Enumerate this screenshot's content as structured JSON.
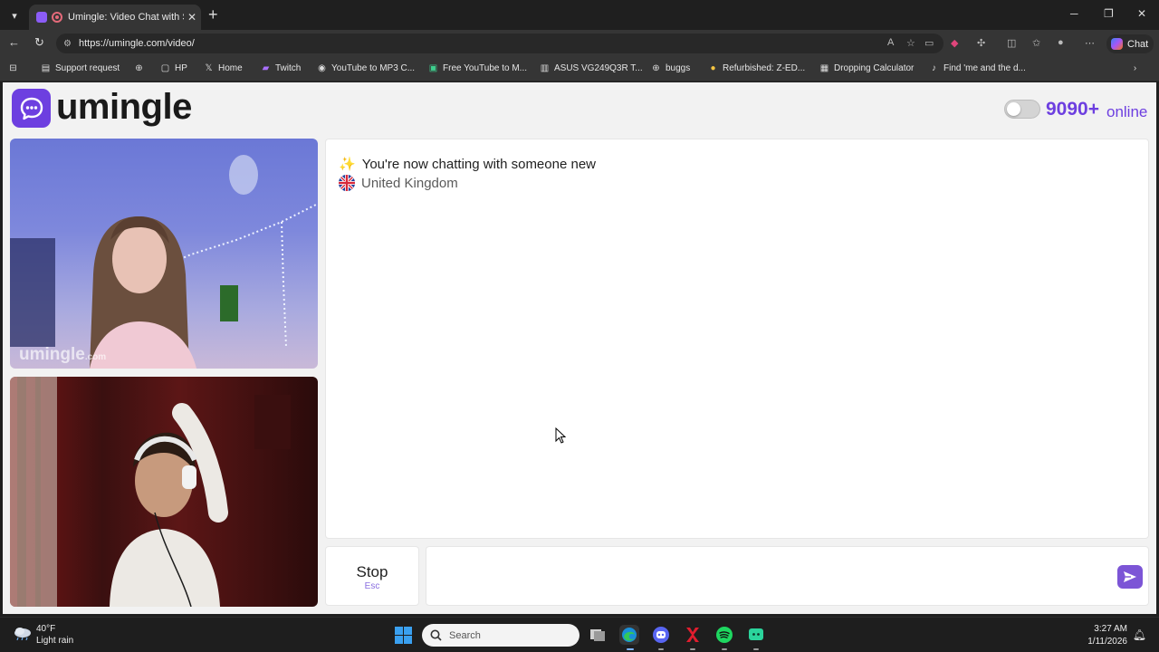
{
  "browser": {
    "tab_title": "Umingle: Video Chat with Stra",
    "url": "https://umingle.com/video/",
    "chat_label": "Chat"
  },
  "bookmarks": [
    {
      "label": "Support request",
      "icon": "doc-icon"
    },
    {
      "label": "",
      "icon": "globe-icon"
    },
    {
      "label": "HP",
      "icon": "folder-icon"
    },
    {
      "label": "Home",
      "icon": "x-icon"
    },
    {
      "label": "Twitch",
      "icon": "twitch-icon"
    },
    {
      "label": "YouTube to MP3 C...",
      "icon": "site-icon"
    },
    {
      "label": "Free YouTube to M...",
      "icon": "site-icon"
    },
    {
      "label": "ASUS VG249Q3R T...",
      "icon": "site-icon"
    },
    {
      "label": "buggs",
      "icon": "globe-icon"
    },
    {
      "label": "Refurbished: Z-ED...",
      "icon": "site-icon"
    },
    {
      "label": "Dropping Calculator",
      "icon": "calculator-icon"
    },
    {
      "label": "Find 'me and the d...",
      "icon": "tiktok-icon"
    }
  ],
  "site": {
    "logo_text": "umingle",
    "online_count": "9090+",
    "online_label": "online",
    "brand_color": "#6d3fe0"
  },
  "video": {
    "watermark": "umingle",
    "watermark_suffix": ".com"
  },
  "chat": {
    "intro_icon": "✨",
    "intro_text": "You're now chatting with someone new",
    "country": "United Kingdom"
  },
  "controls": {
    "stop_label": "Stop",
    "stop_hint": "Esc",
    "message_placeholder": ""
  },
  "taskbar": {
    "temperature": "40°F",
    "weather": "Light rain",
    "search_placeholder": "Search",
    "time": "3:27 AM",
    "date": "1/11/2026"
  }
}
